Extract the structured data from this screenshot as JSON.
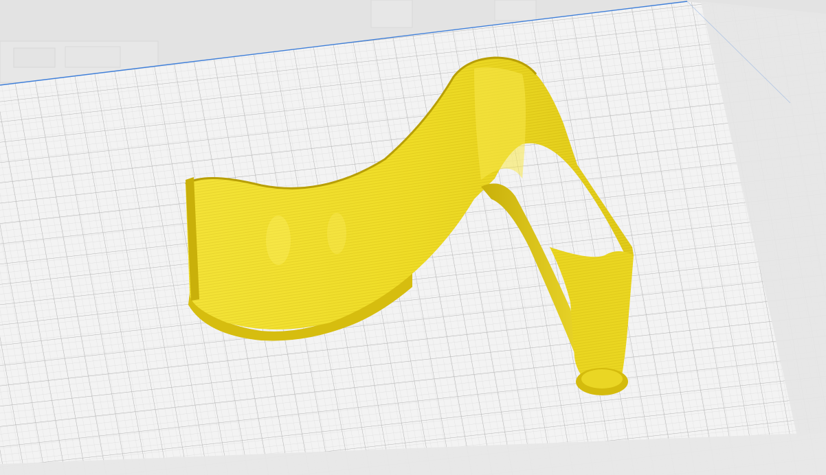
{
  "colors": {
    "background": "#e4e4e4",
    "plate_fill": "#f3f3f3",
    "grid_minor": "#d9d9d9",
    "grid_major": "#b4b4b4",
    "build_volume_edge": "#3f7fd9",
    "model_fill": "#f1e02c",
    "model_shade": "#d9c313",
    "model_dark": "#b59d05",
    "model_highlight": "#fff06a"
  },
  "icons": {
    "printer_frame": "printer-frame-icon"
  }
}
